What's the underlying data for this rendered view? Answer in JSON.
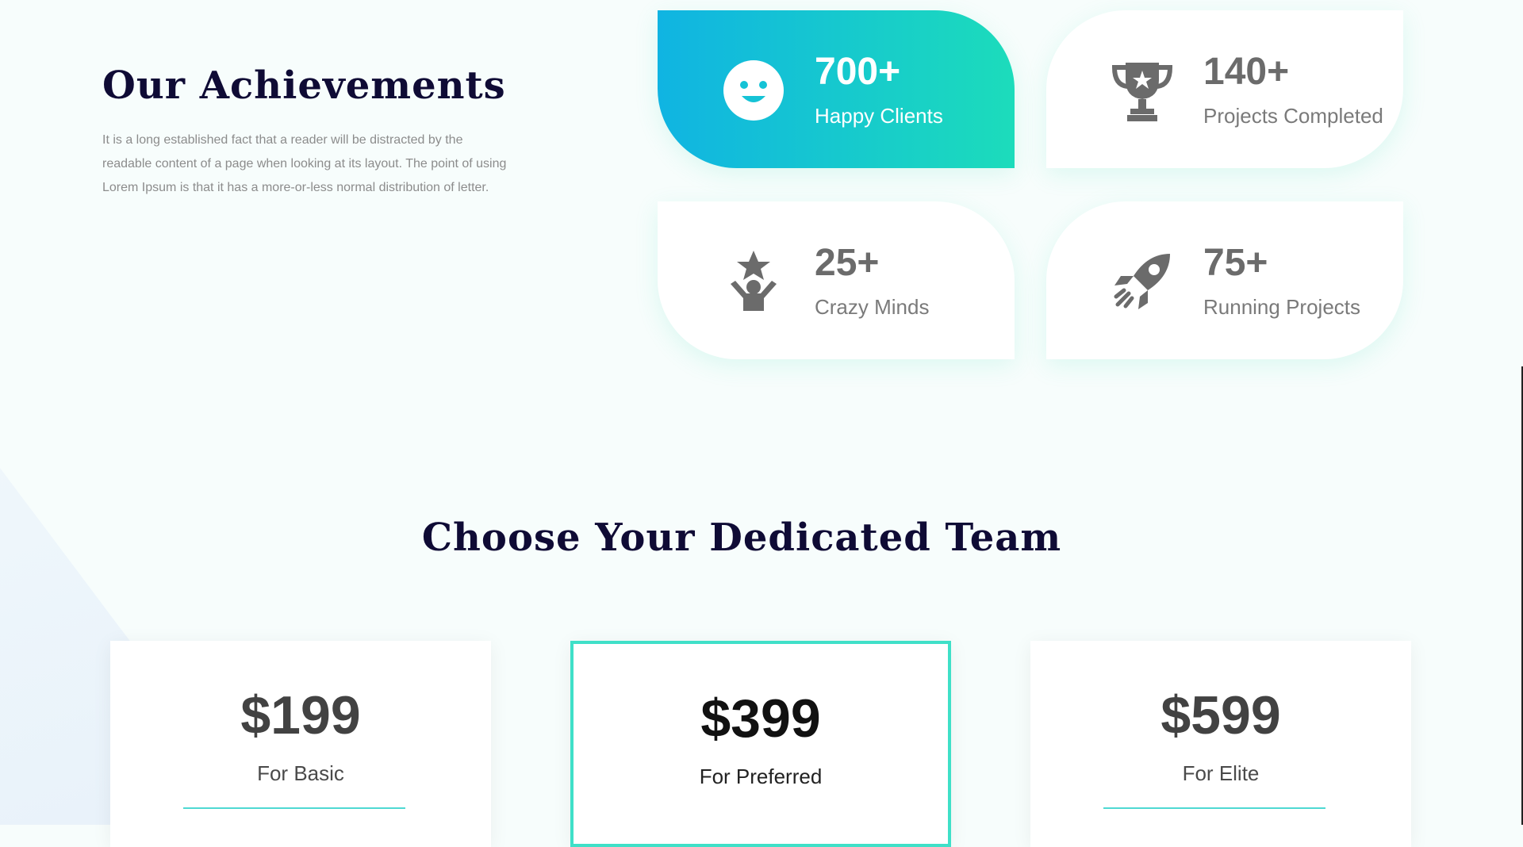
{
  "achievements": {
    "title": "Our Achievements",
    "description": "It is a long established fact that a reader will be distracted by the readable content of a page when looking at its layout. The point of using Lorem Ipsum is that it has a more-or-less normal distribution of letter.",
    "stats": [
      {
        "value": "700+",
        "label": "Happy Clients",
        "icon": "smile-icon",
        "active": true
      },
      {
        "value": "140+",
        "label": "Projects Completed",
        "icon": "trophy-icon",
        "active": false
      },
      {
        "value": "25+",
        "label": "Crazy Minds",
        "icon": "star-person-icon",
        "active": false
      },
      {
        "value": "75+",
        "label": "Running Projects",
        "icon": "rocket-icon",
        "active": false
      }
    ]
  },
  "team": {
    "title": "Choose Your Dedicated Team",
    "plans": [
      {
        "price": "$199",
        "name": "For Basic",
        "highlighted": false
      },
      {
        "price": "$399",
        "name": "For Preferred",
        "highlighted": true
      },
      {
        "price": "$599",
        "name": "For Elite",
        "highlighted": false
      }
    ]
  },
  "colors": {
    "gradient_start": "#10b4e2",
    "gradient_end": "#1cdcbb",
    "heading": "#0f0b35",
    "accent_border": "#3fe0c8"
  }
}
